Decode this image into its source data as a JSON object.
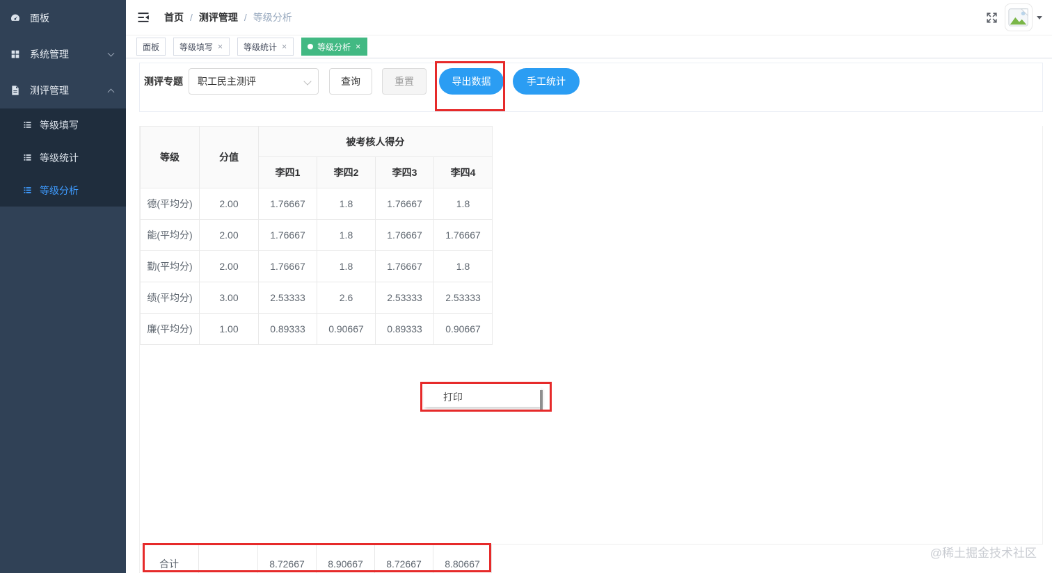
{
  "sidebar": {
    "items": [
      {
        "label": "面板",
        "icon": "dashboard-icon"
      },
      {
        "label": "系统管理",
        "icon": "grid-icon",
        "chevron": "down"
      },
      {
        "label": "测评管理",
        "icon": "form-icon",
        "chevron": "up"
      }
    ],
    "submenu": [
      {
        "label": "等级填写",
        "icon": "list-icon",
        "active": false
      },
      {
        "label": "等级统计",
        "icon": "list-icon",
        "active": false
      },
      {
        "label": "等级分析",
        "icon": "list-icon",
        "active": true
      }
    ]
  },
  "navbar": {
    "breadcrumb": [
      "首页",
      "测评管理",
      "等级分析"
    ],
    "separator": "/"
  },
  "tabs": [
    {
      "label": "面板",
      "closable": false,
      "active": false
    },
    {
      "label": "等级填写",
      "closable": true,
      "active": false
    },
    {
      "label": "等级统计",
      "closable": true,
      "active": false
    },
    {
      "label": "等级分析",
      "closable": true,
      "active": true
    }
  ],
  "filter": {
    "label": "测评专题",
    "select_value": "职工民主测评",
    "query_label": "查询",
    "reset_label": "重置",
    "export_label": "导出数据",
    "manual_label": "手工统计"
  },
  "table": {
    "col_grade": "等级",
    "col_score": "分值",
    "col_group": "被考核人得分",
    "persons": [
      "李四1",
      "李四2",
      "李四3",
      "李四4"
    ],
    "rows": [
      {
        "grade": "德(平均分)",
        "score": "2.00",
        "values": [
          "1.76667",
          "1.8",
          "1.76667",
          "1.8"
        ]
      },
      {
        "grade": "能(平均分)",
        "score": "2.00",
        "values": [
          "1.76667",
          "1.8",
          "1.76667",
          "1.76667"
        ]
      },
      {
        "grade": "勤(平均分)",
        "score": "2.00",
        "values": [
          "1.76667",
          "1.8",
          "1.76667",
          "1.8"
        ]
      },
      {
        "grade": "绩(平均分)",
        "score": "3.00",
        "values": [
          "2.53333",
          "2.6",
          "2.53333",
          "2.53333"
        ]
      },
      {
        "grade": "廉(平均分)",
        "score": "1.00",
        "values": [
          "0.89333",
          "0.90667",
          "0.89333",
          "0.90667"
        ]
      }
    ],
    "total": {
      "label": "合计",
      "score": "",
      "values": [
        "8.72667",
        "8.90667",
        "8.72667",
        "8.80667"
      ]
    }
  },
  "print_menu": {
    "label": "打印"
  },
  "watermark": "@稀土掘金技术社区",
  "icons": {
    "close": "×"
  },
  "colors": {
    "sidebar_bg": "#304156",
    "submenu_bg": "#1f2d3d",
    "active_tab_green": "#42b983",
    "primary_blue": "#2b9df3",
    "active_link_blue": "#3e9bff",
    "annotation_red": "#e62a2a"
  }
}
